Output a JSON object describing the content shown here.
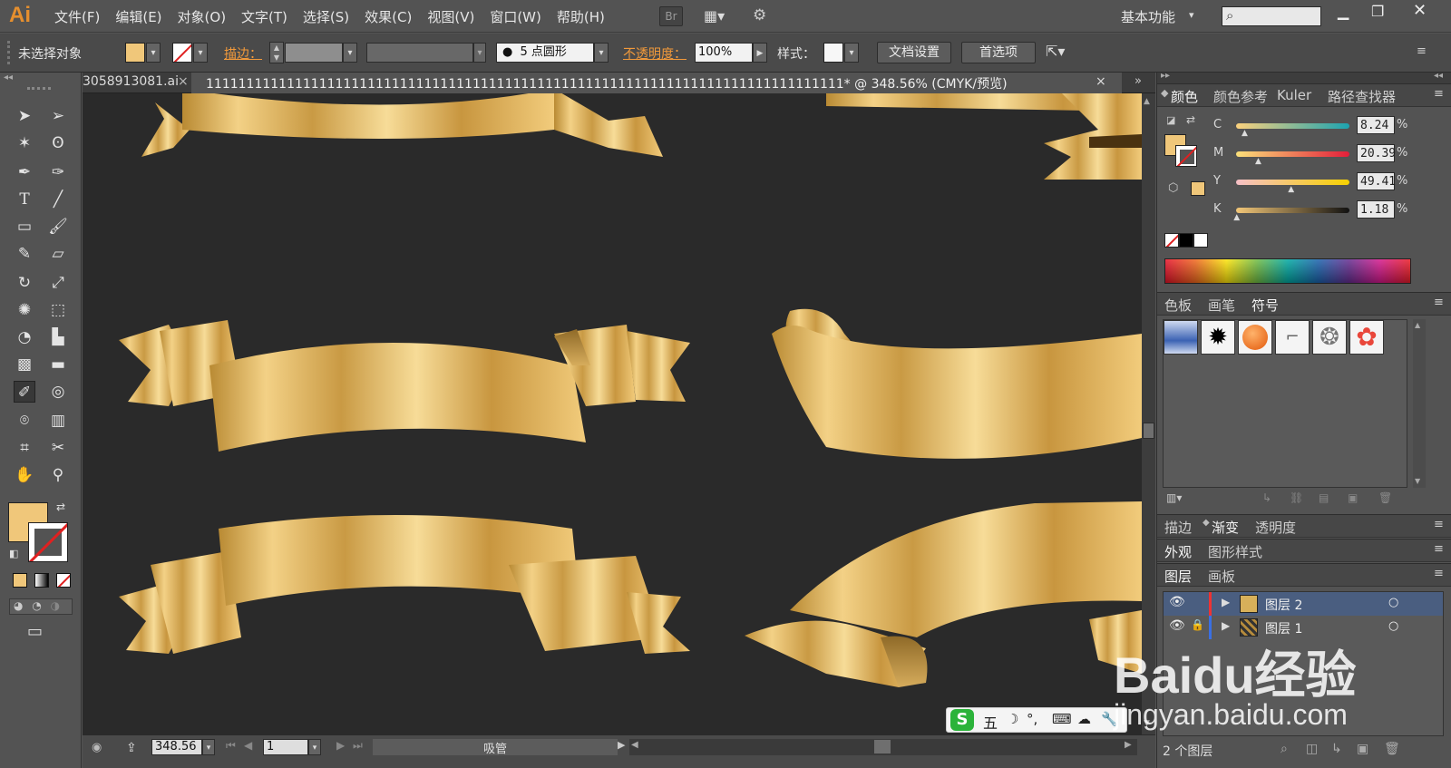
{
  "app": {
    "logo": "Ai",
    "workspace": "基本功能"
  },
  "menu": [
    "文件(F)",
    "编辑(E)",
    "对象(O)",
    "文字(T)",
    "选择(S)",
    "效果(C)",
    "视图(V)",
    "窗口(W)",
    "帮助(H)"
  ],
  "toolbar_top": {
    "bridge": "Br"
  },
  "options": {
    "selection": "未选择对象",
    "stroke_label": "描边：",
    "brush_value": "5 点圆形",
    "opacity_label": "不透明度：",
    "opacity_value": "100%",
    "style_label": "样式：",
    "doc_setup": "文档设置",
    "preferences": "首选项"
  },
  "tabs": [
    {
      "label": "3058913081.ai"
    },
    {
      "label": "1111111111111111111111111111111111111111111111111111111111111111111111111111111* @ 348.56% (CMYK/预览)"
    }
  ],
  "color_panel": {
    "tabs": [
      "颜色",
      "颜色参考",
      "Kuler",
      "路径查找器"
    ],
    "channels": [
      {
        "name": "C",
        "value": "8.24",
        "frac": 0.08
      },
      {
        "name": "M",
        "value": "20.39",
        "frac": 0.2
      },
      {
        "name": "Y",
        "value": "49.41",
        "frac": 0.49
      },
      {
        "name": "K",
        "value": "1.18",
        "frac": 0.01
      }
    ],
    "percent": "%",
    "fill_color": "#f0c77a"
  },
  "symbol_panel": {
    "tabs": [
      "色板",
      "画笔",
      "符号"
    ]
  },
  "gradient_panel": {
    "tabs": [
      "描边",
      "渐变",
      "透明度"
    ]
  },
  "appearance_panel": {
    "tabs": [
      "外观",
      "图形样式"
    ]
  },
  "layers_panel": {
    "tabs": [
      "图层",
      "画板"
    ],
    "layers": [
      {
        "name": "图层 2"
      },
      {
        "name": "图层 1"
      }
    ],
    "count": "2 个图层"
  },
  "status": {
    "zoom": "348.56",
    "page": "1",
    "tool": "吸管"
  },
  "ime": {
    "label": "五"
  },
  "watermark": {
    "brand": "Baidu经验",
    "url": "jingyan.baidu.com"
  }
}
